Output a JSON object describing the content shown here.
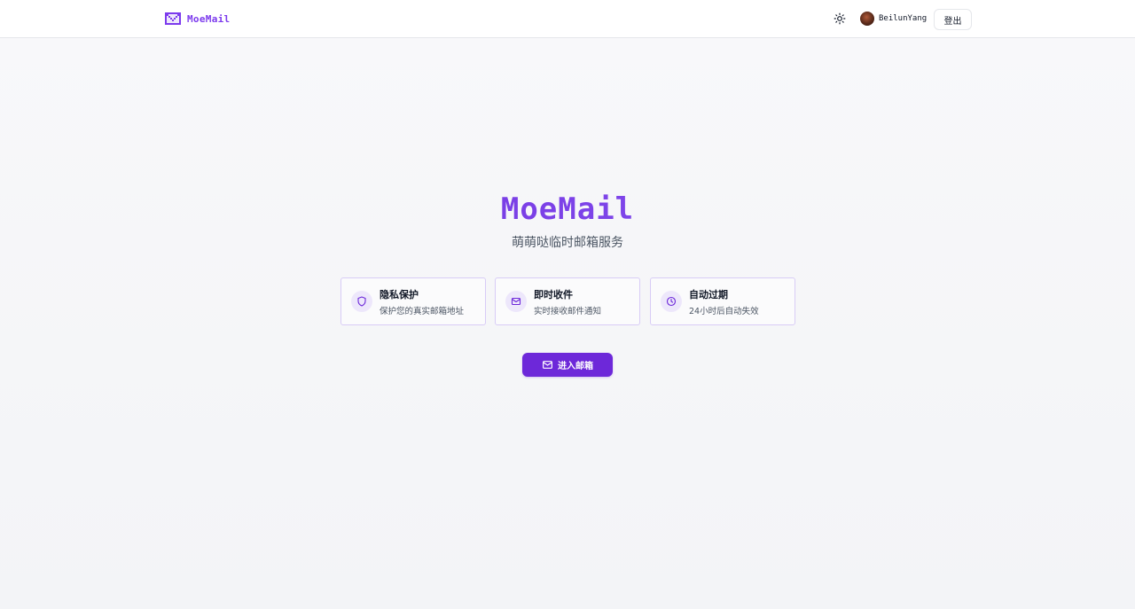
{
  "header": {
    "brand_name": "MoeMail",
    "brand_icon": "mail-logo-icon",
    "theme_icon": "sun-icon",
    "user": {
      "name": "BeilunYang",
      "avatar_icon": "avatar"
    },
    "logout_label": "登出"
  },
  "hero": {
    "title": "MoeMail",
    "subtitle": "萌萌哒临时邮箱服务"
  },
  "features": [
    {
      "icon": "shield-icon",
      "title": "隐私保护",
      "description": "保护您的真实邮箱地址"
    },
    {
      "icon": "mail-icon",
      "title": "即时收件",
      "description": "实时接收邮件通知"
    },
    {
      "icon": "clock-icon",
      "title": "自动过期",
      "description": "24小时后自动失效"
    }
  ],
  "cta": {
    "label": "进入邮箱",
    "icon": "mail-icon"
  },
  "colors": {
    "accent": "#6d28d9",
    "accent_light": "#ede7fb",
    "card_border": "#d8ccf6",
    "background": "#f5f6f8"
  }
}
